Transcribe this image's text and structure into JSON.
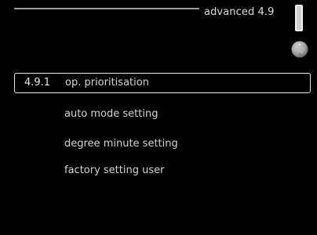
{
  "header": {
    "menu_title": "advanced 4.9"
  },
  "icons": {
    "thermometer": "thermometer-icon",
    "knob": "control-knob-icon"
  },
  "menu": {
    "items": [
      {
        "number": "4.9.1",
        "label": "op. prioritisation",
        "selected": true
      },
      {
        "number": "",
        "label": "auto mode setting",
        "selected": false
      },
      {
        "number": "",
        "label": "degree minute setting",
        "selected": false
      },
      {
        "number": "",
        "label": "factory setting user",
        "selected": false
      }
    ]
  },
  "colors": {
    "background": "#000000",
    "text": "#d6d6d6",
    "selection_border": "#e6e6e6"
  }
}
